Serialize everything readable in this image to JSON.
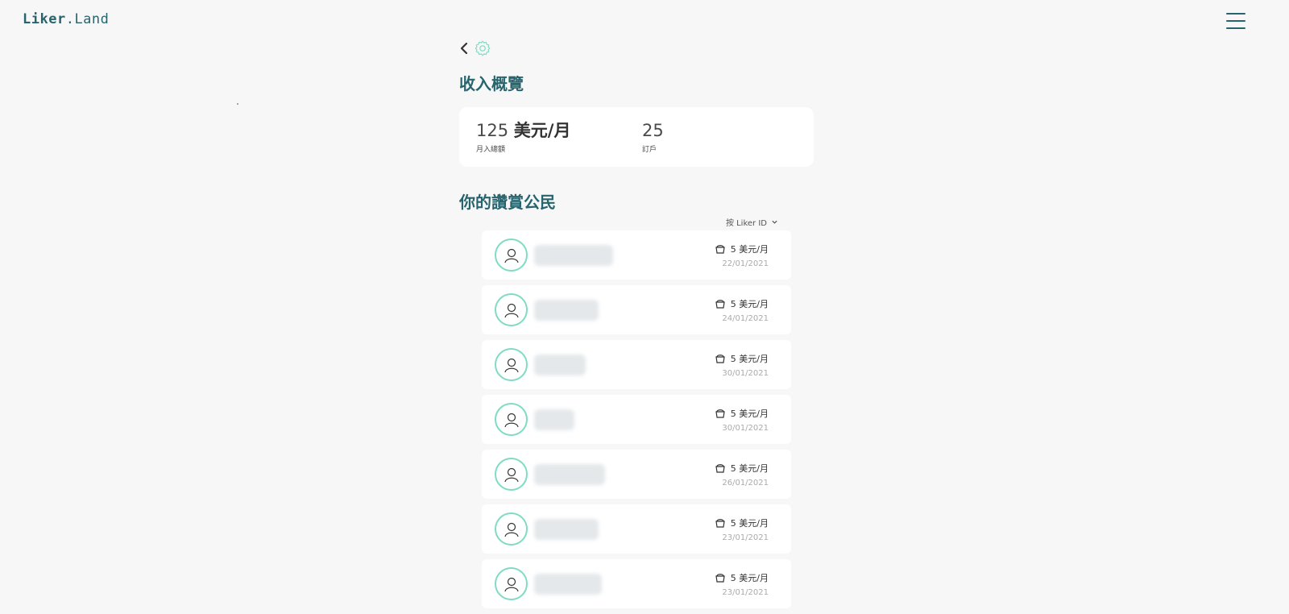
{
  "header": {
    "logo_main": "Liker",
    "logo_dot": ".",
    "logo_sub": "Land"
  },
  "overview": {
    "title": "收入概覽",
    "monthly_value": "125",
    "monthly_unit": "美元/月",
    "monthly_label": "月入總額",
    "subscribers_value": "25",
    "subscribers_label": "訂戶"
  },
  "supporters": {
    "title": "你的讚賞公民",
    "sort_label": "按 Liker ID",
    "items": [
      {
        "amount": "5 美元/月",
        "date": "22/01/2021"
      },
      {
        "amount": "5 美元/月",
        "date": "24/01/2021"
      },
      {
        "amount": "5 美元/月",
        "date": "30/01/2021"
      },
      {
        "amount": "5 美元/月",
        "date": "30/01/2021"
      },
      {
        "amount": "5 美元/月",
        "date": "26/01/2021"
      },
      {
        "amount": "5 美元/月",
        "date": "23/01/2021"
      },
      {
        "amount": "5 美元/月",
        "date": "23/01/2021"
      }
    ]
  },
  "icons": {
    "back": "chevron-left-icon",
    "settings": "gear-icon",
    "menu": "hamburger-icon",
    "avatar": "user-avatar-icon",
    "amount": "cup-icon",
    "sort": "chevron-down-icon"
  },
  "colors": {
    "primary": "#28646e",
    "accent": "#7fdcc3",
    "background": "#f7f7f7",
    "card": "#ffffff"
  }
}
